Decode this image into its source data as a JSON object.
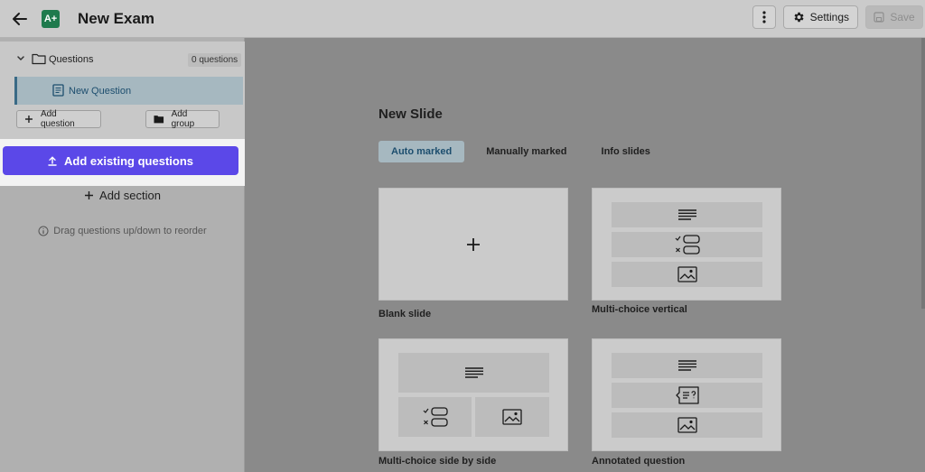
{
  "header": {
    "title": "New Exam",
    "logo_text": "A+",
    "settings_label": "Settings",
    "save_label": "Save"
  },
  "sidebar": {
    "folder_label": "Questions",
    "folder_badge": "0 questions",
    "question_label": "New Question",
    "add_question_label": "Add question",
    "add_group_label": "Add group",
    "add_existing_label": "Add existing questions",
    "add_section_label": "Add section",
    "hint_text": "Drag questions up/down to reorder"
  },
  "main": {
    "title": "New Slide",
    "tabs": [
      {
        "label": "Auto marked",
        "active": true
      },
      {
        "label": "Manually marked",
        "active": false
      },
      {
        "label": "Info slides",
        "active": false
      }
    ],
    "cards": [
      {
        "label": "Blank slide"
      },
      {
        "label": "Multi-choice vertical"
      },
      {
        "label": "Multi-choice side by side"
      },
      {
        "label": "Annotated question"
      }
    ]
  },
  "colors": {
    "accent": "#5b48e8",
    "selected_bg": "#a6b8c0",
    "selected_text": "#1d4e6e",
    "logo": "#1f7a4d"
  }
}
